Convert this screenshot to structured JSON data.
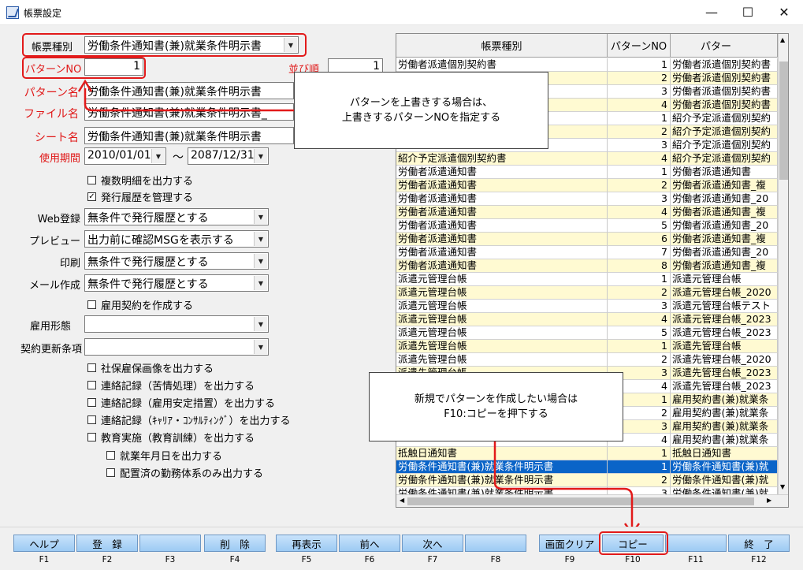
{
  "window": {
    "title": "帳票設定",
    "minimize": "—",
    "maximize": "☐",
    "close": "✕"
  },
  "form": {
    "report_type_label": "帳票種別",
    "report_type_value": "労働条件通知書(兼)就業条件明示書",
    "pattern_no_label": "パターンNO",
    "pattern_no_value": "1",
    "sort_label": "並び順",
    "sort_value": "1",
    "pattern_name_label": "パターン名",
    "pattern_name_value": "労働条件通知書(兼)就業条件明示書",
    "file_name_label": "ファイル名",
    "file_name_value": "労働条件通知書(兼)就業条件明示書_",
    "sheet_name_label": "シート名",
    "sheet_name_value": "労働条件通知書(兼)就業条件明示書",
    "period_label": "使用期間",
    "period_from": "2010/01/01",
    "period_tilde": "～",
    "period_to": "2087/12/31",
    "cb_multi_detail": {
      "label": "複数明細を出力する",
      "mark": ""
    },
    "cb_history": {
      "label": "発行履歴を管理する",
      "mark": "✓"
    },
    "web_label": "Web登録",
    "web_value": "無条件で発行履歴とする",
    "preview_label": "プレビュー",
    "preview_value": "出力前に確認MSGを表示する",
    "print_label": "印刷",
    "print_value": "無条件で発行履歴とする",
    "mail_label": "メール作成",
    "mail_value": "無条件で発行履歴とする",
    "cb_contract": {
      "label": "雇用契約を作成する",
      "mark": ""
    },
    "employment_label": "雇用形態",
    "employment_value": "",
    "renewal_label": "契約更新条項",
    "renewal_value": "",
    "cb_insurance": {
      "label": "社保雇保画像を出力する",
      "mark": ""
    },
    "cb_complaint": {
      "label": "連絡記録（苦情処理）を出力する",
      "mark": ""
    },
    "cb_stability": {
      "label": "連絡記録（雇用安定措置）を出力する",
      "mark": ""
    },
    "cb_career": {
      "label": "連絡記録（ｷｬﾘｱ・ｺﾝｻﾙﾃｨﾝｸﾞ）を出力する",
      "mark": ""
    },
    "cb_education": {
      "label": "教育実施（教育訓練）を出力する",
      "mark": ""
    },
    "cb_work_date": {
      "label": "就業年月日を出力する",
      "mark": ""
    },
    "cb_assigned": {
      "label": "配置済の勤務体系のみ出力する",
      "mark": ""
    }
  },
  "grid": {
    "headers": [
      "帳票種別",
      "パターンNO",
      "パター"
    ],
    "rows": [
      [
        "労働者派遣個別契約書",
        "1",
        "労働者派遣個別契約書"
      ],
      [
        "",
        "2",
        "労働者派遣個別契約書"
      ],
      [
        "",
        "3",
        "労働者派遣個別契約書"
      ],
      [
        "",
        "4",
        "労働者派遣個別契約書"
      ],
      [
        "",
        "1",
        "紹介予定派遣個別契約"
      ],
      [
        "",
        "2",
        "紹介予定派遣個別契約"
      ],
      [
        "",
        "3",
        "紹介予定派遣個別契約"
      ],
      [
        "紹介予定派遣個別契約書",
        "4",
        "紹介予定派遣個別契約"
      ],
      [
        "労働者派遣通知書",
        "1",
        "労働者派遣通知書"
      ],
      [
        "労働者派遣通知書",
        "2",
        "労働者派遣通知書_複"
      ],
      [
        "労働者派遣通知書",
        "3",
        "労働者派遣通知書_20"
      ],
      [
        "労働者派遣通知書",
        "4",
        "労働者派遣通知書_複"
      ],
      [
        "労働者派遣通知書",
        "5",
        "労働者派遣通知書_20"
      ],
      [
        "労働者派遣通知書",
        "6",
        "労働者派遣通知書_複"
      ],
      [
        "労働者派遣通知書",
        "7",
        "労働者派遣通知書_20"
      ],
      [
        "労働者派遣通知書",
        "8",
        "労働者派遣通知書_複"
      ],
      [
        "派遣元管理台帳",
        "1",
        "派遣元管理台帳"
      ],
      [
        "派遣元管理台帳",
        "2",
        "派遣元管理台帳_2020"
      ],
      [
        "派遣元管理台帳",
        "3",
        "派遣元管理台帳テスト"
      ],
      [
        "派遣元管理台帳",
        "4",
        "派遣元管理台帳_2023"
      ],
      [
        "派遣元管理台帳",
        "5",
        "派遣元管理台帳_2023"
      ],
      [
        "派遣先管理台帳",
        "1",
        "派遣先管理台帳"
      ],
      [
        "派遣先管理台帳",
        "2",
        "派遣先管理台帳_2020"
      ],
      [
        "派遣先管理台帳",
        "3",
        "派遣先管理台帳_2023"
      ],
      [
        "",
        "4",
        "派遣先管理台帳_2023"
      ],
      [
        "",
        "1",
        "雇用契約書(兼)就業条"
      ],
      [
        "",
        "2",
        "雇用契約書(兼)就業条"
      ],
      [
        "",
        "3",
        "雇用契約書(兼)就業条"
      ],
      [
        "",
        "4",
        "雇用契約書(兼)就業条"
      ],
      [
        "抵触日通知書",
        "1",
        "抵触日通知書"
      ],
      [
        "労働条件通知書(兼)就業条件明示書",
        "1",
        "労働条件通知書(兼)就"
      ],
      [
        "労働条件通知書(兼)就業条件明示書",
        "2",
        "労働条件通知書(兼)就"
      ],
      [
        "労働条件通知書(兼)就業条件明示書",
        "3",
        "労働条件通知書(兼)就"
      ]
    ],
    "selected_index": 30
  },
  "callouts": {
    "top": [
      "パターンを上書きする場合は、",
      "上書きするパターンNOを指定する"
    ],
    "bottom": [
      "新規でパターンを作成したい場合は",
      "F10:コピーを押下する"
    ]
  },
  "fkeys": [
    {
      "label": "ヘルプ",
      "key": "F1"
    },
    {
      "label": "登　録",
      "key": "F2"
    },
    {
      "label": "",
      "key": "F3"
    },
    {
      "label": "削　除",
      "key": "F4"
    },
    {
      "label": "再表示",
      "key": "F5"
    },
    {
      "label": "前へ",
      "key": "F6"
    },
    {
      "label": "次へ",
      "key": "F7"
    },
    {
      "label": "",
      "key": "F8"
    },
    {
      "label": "画面クリア",
      "key": "F9"
    },
    {
      "label": "コピー",
      "key": "F10"
    },
    {
      "label": "",
      "key": "F11"
    },
    {
      "label": "終　了",
      "key": "F12"
    }
  ],
  "colors": {
    "highlight": "#e21a1a",
    "row_alt": "#fffad2",
    "selected": "#0a64c8",
    "button": "#9ccaf3"
  }
}
